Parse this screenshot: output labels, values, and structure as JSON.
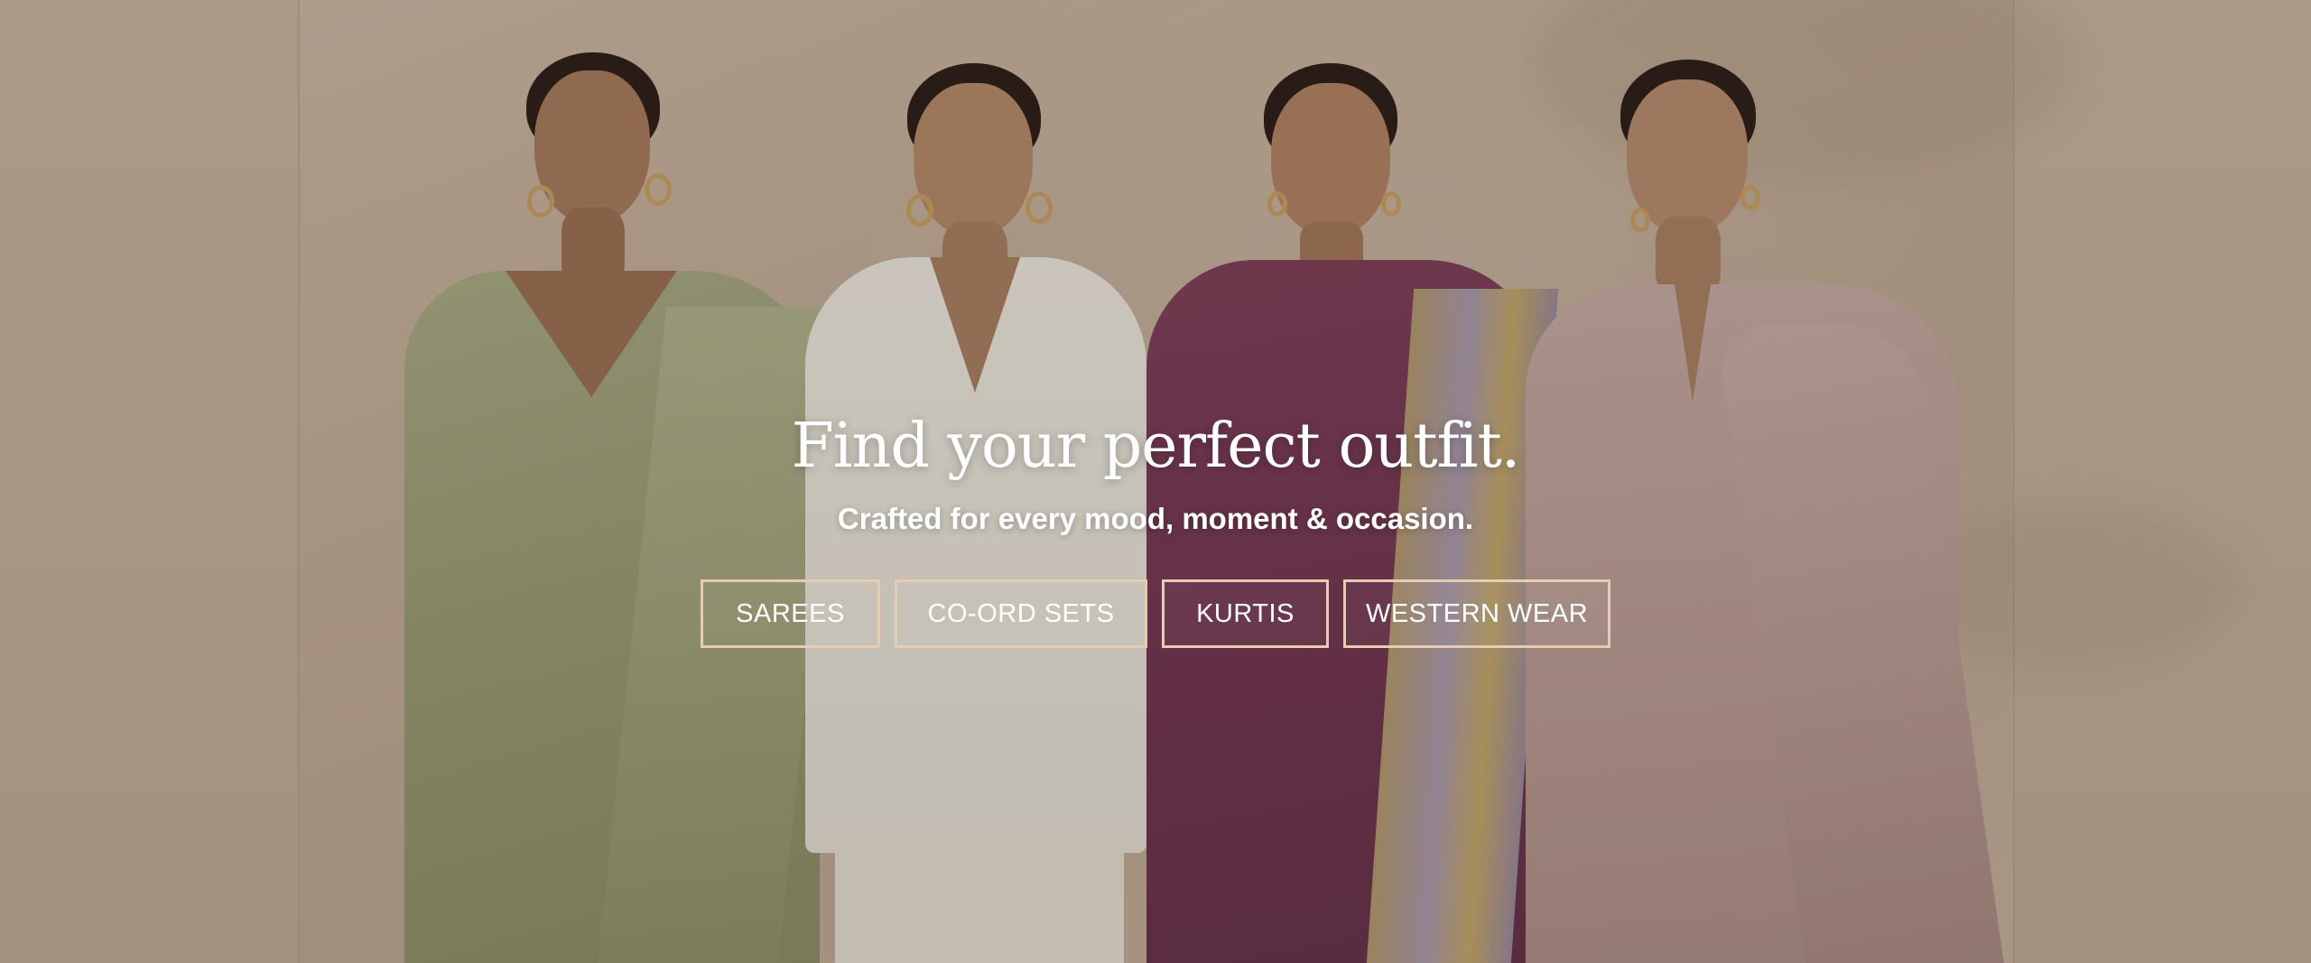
{
  "hero": {
    "headline": "Find your perfect outfit.",
    "subline": "Crafted for every mood, moment & occasion."
  },
  "categories": [
    {
      "label": "SAREES"
    },
    {
      "label": "CO-ORD SETS"
    },
    {
      "label": "KURTIS"
    },
    {
      "label": "WESTERN WEAR"
    }
  ],
  "colors": {
    "button_border": "#e6ccb2",
    "text": "#ffffff",
    "background": "#c7b3a0"
  }
}
